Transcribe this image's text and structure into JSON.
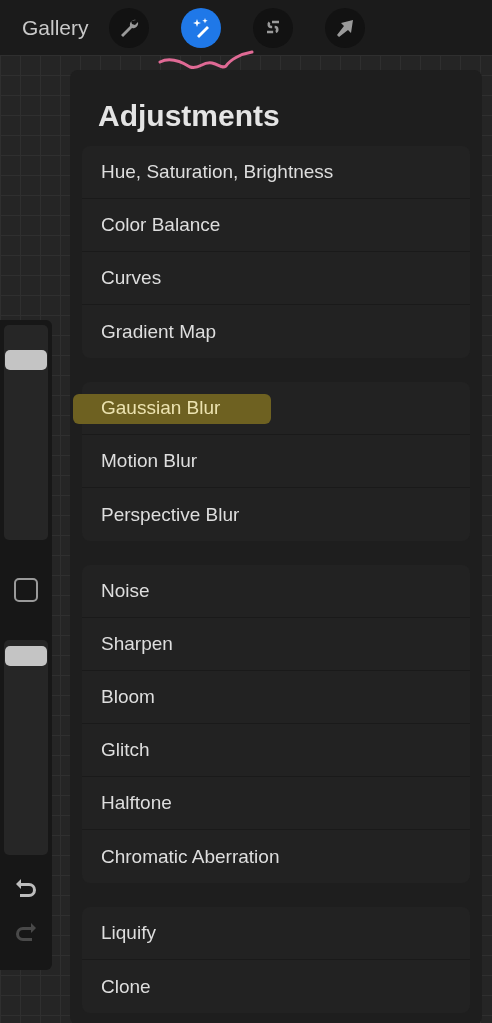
{
  "toolbar": {
    "gallery": "Gallery",
    "tools": [
      {
        "kind": "wrench",
        "selected": false
      },
      {
        "kind": "wand",
        "selected": true
      },
      {
        "kind": "selection",
        "selected": false
      },
      {
        "kind": "arrow",
        "selected": false
      }
    ]
  },
  "sidebar": {
    "sliders": [
      {
        "level": 0.87
      },
      {
        "level": 0.97
      }
    ],
    "redo": {
      "disabled": true
    }
  },
  "panel": {
    "title": "Adjustments",
    "groups": [
      [
        {
          "label": "Hue, Saturation, Brightness",
          "highlighted": false
        },
        {
          "label": "Color Balance",
          "highlighted": false
        },
        {
          "label": "Curves",
          "highlighted": false
        },
        {
          "label": "Gradient Map",
          "highlighted": false
        }
      ],
      [
        {
          "label": "Gaussian Blur",
          "highlighted": true
        },
        {
          "label": "Motion Blur",
          "highlighted": false
        },
        {
          "label": "Perspective Blur",
          "highlighted": false
        }
      ],
      [
        {
          "label": "Noise",
          "highlighted": false
        },
        {
          "label": "Sharpen",
          "highlighted": false
        },
        {
          "label": "Bloom",
          "highlighted": false
        },
        {
          "label": "Glitch",
          "highlighted": false
        },
        {
          "label": "Halftone",
          "highlighted": false
        },
        {
          "label": "Chromatic Aberration",
          "highlighted": false
        }
      ],
      [
        {
          "label": "Liquify",
          "highlighted": false
        },
        {
          "label": "Clone",
          "highlighted": false
        }
      ]
    ]
  }
}
